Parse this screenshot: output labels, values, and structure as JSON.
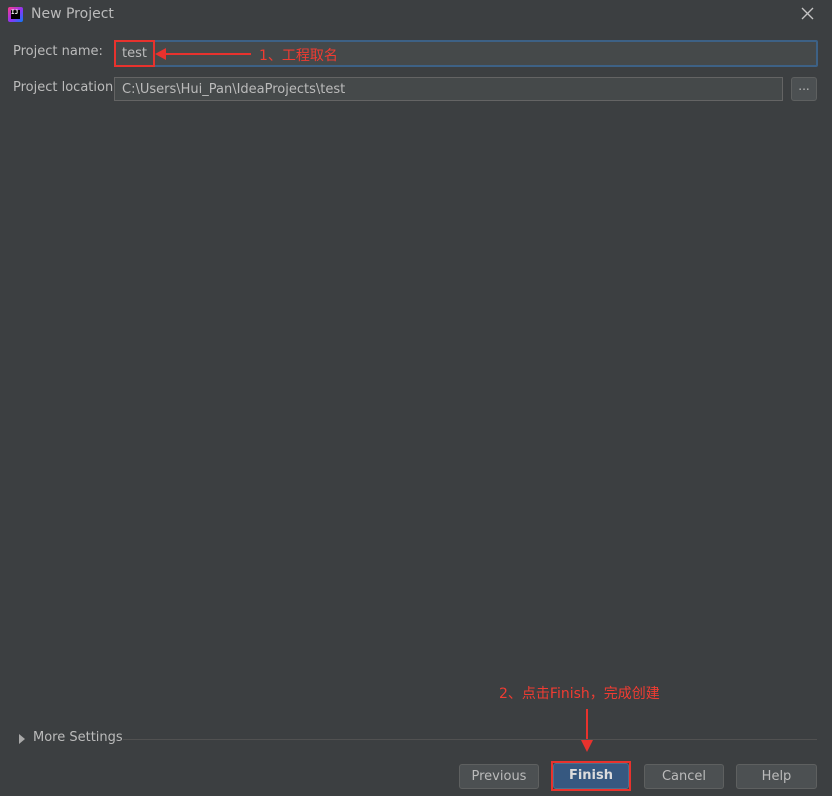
{
  "window": {
    "title": "New Project",
    "app_icon_text": "IJ"
  },
  "form": {
    "project_name_label": "Project name:",
    "project_name_value": "test",
    "project_location_label": "Project location:",
    "project_location_value": "C:\\Users\\Hui_Pan\\IdeaProjects\\test",
    "browse_label": "..."
  },
  "more_settings": {
    "label": "More Settings",
    "expanded": false
  },
  "buttons": {
    "previous": "Previous",
    "finish": "Finish",
    "cancel": "Cancel",
    "help": "Help"
  },
  "annotations": {
    "name_note": "1、工程取名",
    "finish_note": "2、点击Finish，完成创建",
    "color": "#e8322d"
  },
  "colors": {
    "background": "#3c3f41",
    "field_background": "#45494a",
    "focus_border": "#3d6185",
    "default_button": "#365880",
    "text": "#bbbbbb"
  }
}
